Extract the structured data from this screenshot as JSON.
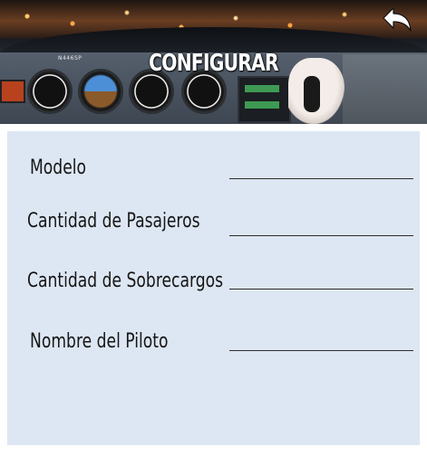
{
  "header": {
    "title": "CONFIGURAR",
    "tail_number": "N446SP",
    "back_icon": "back-arrow-icon"
  },
  "form": {
    "fields": [
      {
        "label": "Modelo",
        "value": ""
      },
      {
        "label": "Cantidad de Pasajeros",
        "value": ""
      },
      {
        "label": "Cantidad de Sobrecargos",
        "value": ""
      },
      {
        "label": "Nombre del Piloto",
        "value": ""
      }
    ]
  },
  "colors": {
    "form_background": "#dde7f3",
    "page_background": "#ffffff",
    "title_text": "#ffffff",
    "label_text": "#161616"
  }
}
